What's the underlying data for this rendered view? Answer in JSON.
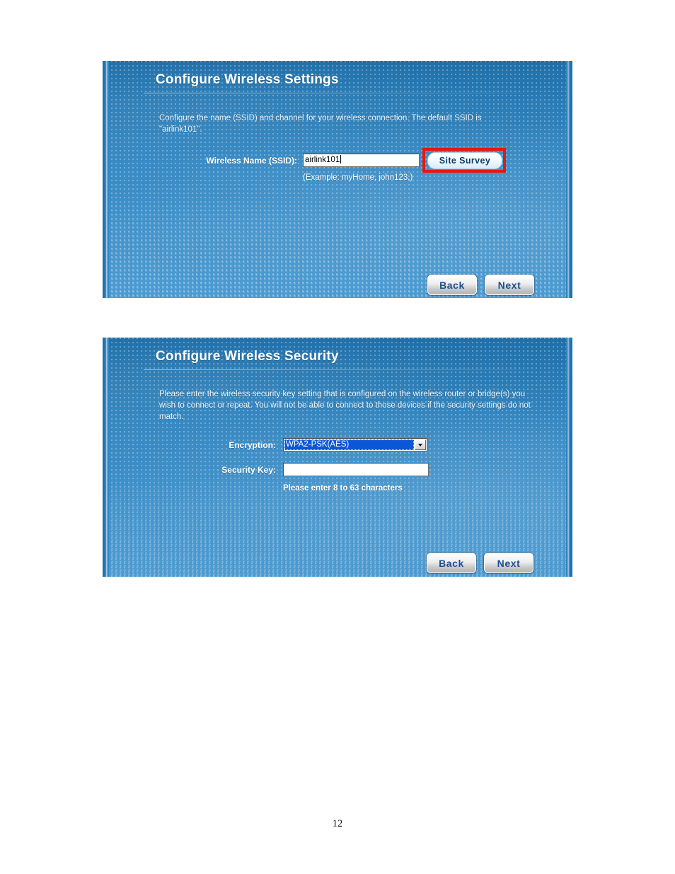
{
  "document": {
    "page_number": "12"
  },
  "panels": [
    {
      "id": "configure-wireless-settings",
      "title": "Configure Wireless Settings",
      "description": "Configure the name (SSID) and channel for your wireless connection. The default SSID is \"airlink101\".",
      "fields": {
        "ssid_label": "Wireless Name (SSID):",
        "ssid_value": "airlink101",
        "ssid_example": "(Example: myHome, john123,)"
      },
      "buttons": {
        "site_survey": "Site Survey",
        "back": "Back",
        "next": "Next"
      },
      "highlight_color": "#e8170d"
    },
    {
      "id": "configure-wireless-security",
      "title": "Configure Wireless Security",
      "description": "Please enter the wireless security key setting that is configured on the wireless router or bridge(s) you wish to connect or repeat. You will not be able to connect to those devices if the security settings do not match.",
      "fields": {
        "encryption_label": "Encryption:",
        "encryption_value": "WPA2-PSK(AES)",
        "security_key_label": "Security Key:",
        "security_key_value": "",
        "security_key_hint": "Please enter 8 to 63 characters"
      },
      "buttons": {
        "back": "Back",
        "next": "Next"
      },
      "selection_color": "#0a58d6"
    }
  ],
  "theme": {
    "panel_top": "#1f6ea8",
    "panel_bottom": "#3f93cd",
    "title_text": "#ffffff",
    "button_text": "#1d4f8c"
  }
}
